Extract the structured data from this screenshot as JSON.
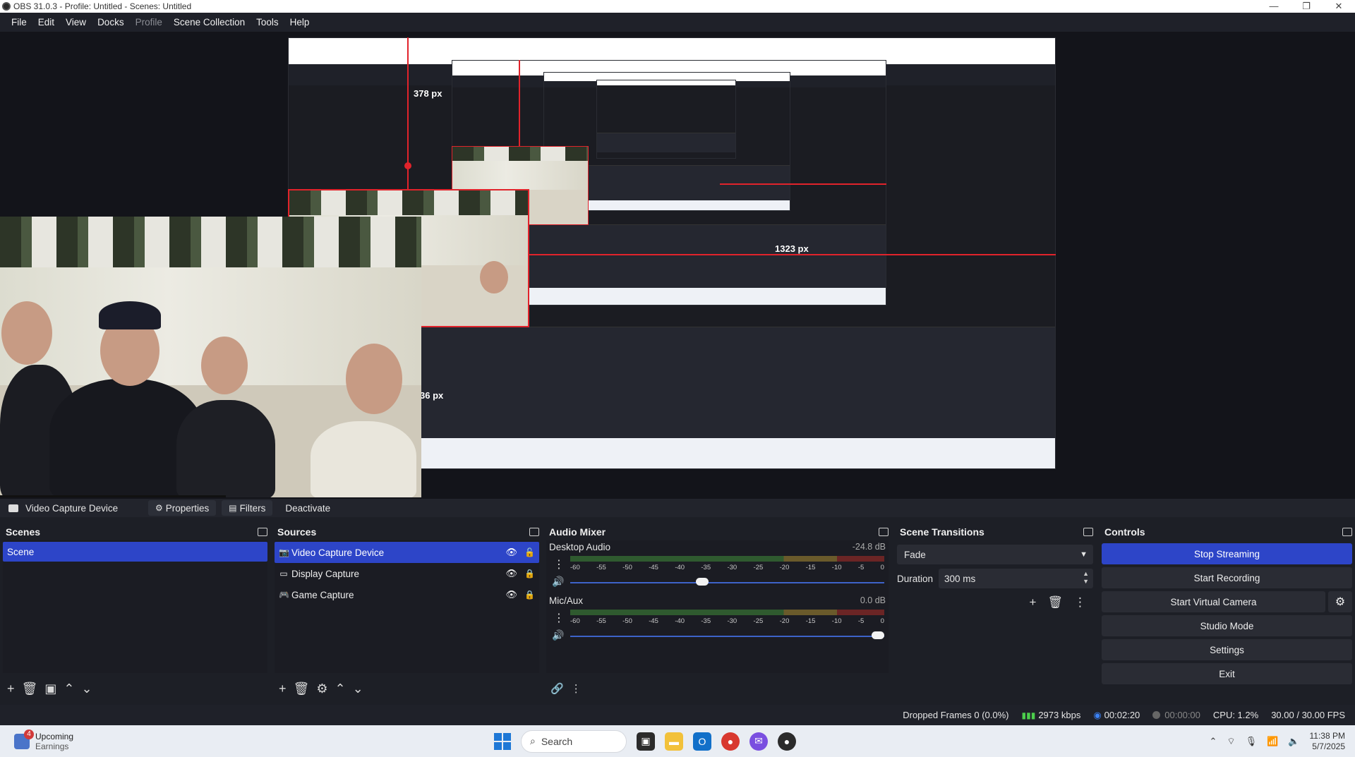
{
  "titlebar": {
    "title": "OBS 31.0.3 - Profile: Untitled - Scenes: Untitled",
    "minimize": "—",
    "maximize": "❐",
    "close": "✕"
  },
  "menu": [
    "File",
    "Edit",
    "View",
    "Docks",
    "Profile",
    "Scene Collection",
    "Tools",
    "Help"
  ],
  "preview": {
    "label_height": "378 px",
    "label_width": "1323 px",
    "label_partial": "36 px"
  },
  "sourcebar": {
    "source_name": "Video Capture Device",
    "properties": "Properties",
    "filters": "Filters",
    "deactivate": "Deactivate"
  },
  "scenes": {
    "title": "Scenes",
    "items": [
      "Scene"
    ]
  },
  "sources": {
    "title": "Sources",
    "items": [
      {
        "label": "Video Capture Device",
        "icon": "camera-icon",
        "selected": true
      },
      {
        "label": "Display Capture",
        "icon": "monitor-icon",
        "selected": false
      },
      {
        "label": "Game Capture",
        "icon": "gamepad-icon",
        "selected": false
      }
    ]
  },
  "mixer": {
    "title": "Audio Mixer",
    "channels": [
      {
        "name": "Desktop Audio",
        "db": "-24.8 dB",
        "level": 0.0,
        "volume": 0.44
      },
      {
        "name": "Mic/Aux",
        "db": "0.0 dB",
        "level": 0.0,
        "volume": 1.0
      }
    ],
    "ticks": [
      "-60",
      "-55",
      "-50",
      "-45",
      "-40",
      "-35",
      "-30",
      "-25",
      "-20",
      "-15",
      "-10",
      "-5",
      "0"
    ]
  },
  "transitions": {
    "title": "Scene Transitions",
    "selected": "Fade",
    "duration_label": "Duration",
    "duration_value": "300 ms"
  },
  "controls": {
    "title": "Controls",
    "stop_streaming": "Stop Streaming",
    "start_recording": "Start Recording",
    "start_virtual_camera": "Start Virtual Camera",
    "studio_mode": "Studio Mode",
    "settings": "Settings",
    "exit": "Exit"
  },
  "status": {
    "dropped_frames": "Dropped Frames 0 (0.0%)",
    "bitrate": "2973 kbps",
    "stream_time": "00:02:20",
    "record_time": "00:00:00",
    "cpu": "CPU: 1.2%",
    "fps": "30.00 / 30.00 FPS"
  },
  "taskbar": {
    "news_title": "Upcoming",
    "news_sub": "Earnings",
    "news_badge": "4",
    "search_placeholder": "Search",
    "time": "11:38 PM",
    "date": "5/7/2025"
  },
  "colors": {
    "accent": "#2d45c8",
    "dock_bg": "#1d1f26",
    "guide_red": "#e1232b",
    "meter_green": "#49d849"
  }
}
